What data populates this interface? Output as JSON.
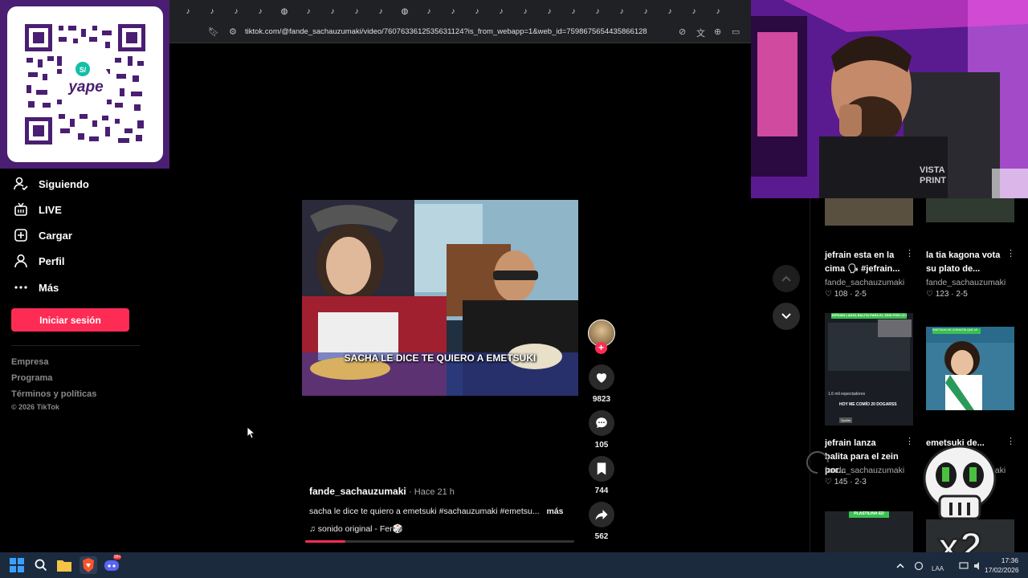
{
  "qr": {
    "brand": "yape",
    "brand_symbol": "S/"
  },
  "sidebar": {
    "items": [
      {
        "label": "Siguiendo",
        "icon": "following-icon"
      },
      {
        "label": "LIVE",
        "icon": "live-icon"
      },
      {
        "label": "Cargar",
        "icon": "upload-icon"
      },
      {
        "label": "Perfil",
        "icon": "profile-icon"
      },
      {
        "label": "Más",
        "icon": "more-icon"
      }
    ],
    "login_label": "Iniciar sesión",
    "footer": [
      "Empresa",
      "Programa",
      "Términos y políticas"
    ],
    "copyright": "© 2026 TikTok"
  },
  "browser": {
    "url": "tiktok.com/@fande_sachauzumaki/video/7607633612535631124?is_from_webapp=1&web_id=7598675654435866128"
  },
  "video": {
    "caption": "SACHA LE DICE TE QUIERO A EMETSUKI",
    "author": "fande_sachauzumaki",
    "time": "· Hace 21 h",
    "description": "sacha le dice te quiero a emetsuki #sachauzumaki #emetsu...",
    "more": "más",
    "sound": "sonido original - Fer🎲",
    "progress": 0.15,
    "likes": "9823",
    "comments": "105",
    "saves": "744",
    "shares": "562"
  },
  "related": [
    {
      "title": "jefrain esta en la cima 🗣 #jefrain...",
      "author": "fande_sachauzumaki",
      "likes": "108",
      "date": "2-5"
    },
    {
      "title": "la tia kagona vota su plato de...",
      "author": "fande_sachauzumaki",
      "likes": "123",
      "date": "2-5"
    },
    {
      "title": "jefrain lanza balita para el zein por...",
      "author": "fande_sachauzumaki",
      "likes": "145",
      "date": "2-3"
    },
    {
      "title": "emetsuki de...",
      "author": "fande_sachauzumaki",
      "likes": "",
      "date": ""
    }
  ],
  "thumb_text": {
    "green_header": "JEFRAIN LANZA BALITA PARA EL ZEIN POR LO DEL EMETSUKI",
    "viewers": "1.6 mil espectadores",
    "chat_line": "HOY ME COMÍO 20 DOGARSS",
    "badge": "Spoiler",
    "em_banner": "EMETSUKI DE CORAZÓN QUE LE",
    "bottom_banner": "PLASTILINA ED"
  },
  "overlay": {
    "text": "x2"
  },
  "taskbar": {
    "lang": "LAA",
    "time": "17:36",
    "date": "17/02/2026",
    "badge": "99+"
  },
  "colors": {
    "accent": "#fe2c55",
    "yape_purple": "#4a1e72"
  }
}
